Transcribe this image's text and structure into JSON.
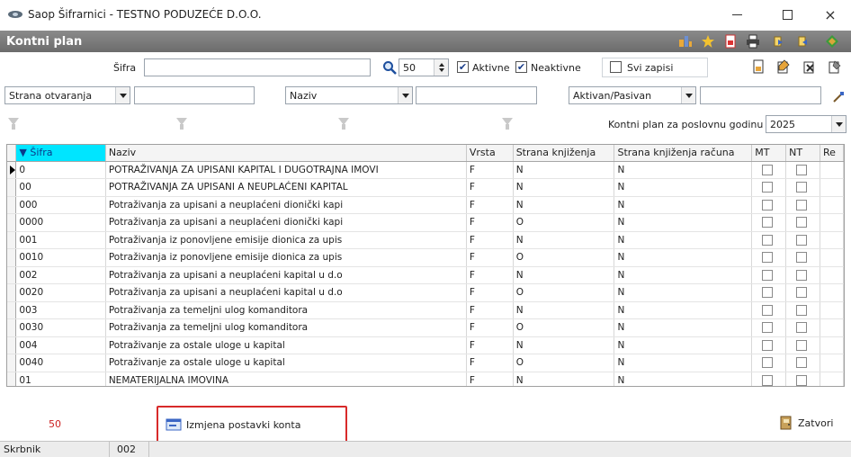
{
  "window": {
    "title": "Saop Šifrarnici - TESTNO PODUZEĆE D.O.O.",
    "minimize": "—",
    "maximize": "□",
    "close": "×"
  },
  "header": {
    "title": "Kontni plan"
  },
  "toolbar": {
    "sifra_label": "Šifra",
    "sifra_value": "",
    "page_size": "50",
    "aktivne_label": "Aktivne",
    "aktivne_checked": true,
    "neaktivne_label": "Neaktivne",
    "neaktivne_checked": true,
    "svi_zapisi_label": "Svi zapisi",
    "svi_zapisi_checked": false
  },
  "filters": {
    "filter1_field": "Strana otvaranja",
    "filter1_value": "",
    "filter2_field": "Naziv",
    "filter2_value": "",
    "filter3_field": "Aktivan/Pasivan",
    "filter3_value": "",
    "year_label": "Kontni plan za poslovnu godinu",
    "year_value": "2025"
  },
  "grid": {
    "columns": [
      "Šifra",
      "Naziv",
      "Vrsta",
      "Strana knjiženja",
      "Strana knjiženja računa",
      "MT",
      "NT",
      "Re"
    ],
    "rows": [
      [
        "0",
        "POTRAŽIVANJA ZA UPISANI KAPITAL I DUGOTRAJNA IMOVI",
        "F",
        "N",
        "N"
      ],
      [
        "00",
        "POTRAŽIVANJA ZA UPISANI A NEUPLAĆENI KAPITAL",
        "F",
        "N",
        "N"
      ],
      [
        "000",
        "Potraživanja za upisani a neuplaćeni dionički kapi",
        "F",
        "N",
        "N"
      ],
      [
        "0000",
        "Potraživanja za upisani a neuplaćeni dionički kapi",
        "F",
        "O",
        "N"
      ],
      [
        "001",
        "Potraživanja iz ponovljene emisije dionica za upis",
        "F",
        "N",
        "N"
      ],
      [
        "0010",
        "Potraživanja iz ponovljene emisije dionica za upis",
        "F",
        "O",
        "N"
      ],
      [
        "002",
        "Potraživanja za upisani a neuplaćeni kapital u d.o",
        "F",
        "N",
        "N"
      ],
      [
        "0020",
        "Potraživanja za upisani a neuplaćeni kapital u d.o",
        "F",
        "O",
        "N"
      ],
      [
        "003",
        "Potraživanja za temeljni ulog komanditora",
        "F",
        "N",
        "N"
      ],
      [
        "0030",
        "Potraživanja za temeljni ulog komanditora",
        "F",
        "O",
        "N"
      ],
      [
        "004",
        "Potraživanje za ostale uloge u kapital",
        "F",
        "N",
        "N"
      ],
      [
        "0040",
        "Potraživanje za ostale uloge u kapital",
        "F",
        "O",
        "N"
      ],
      [
        "01",
        "NEMATERIJALNA IMOVINA",
        "F",
        "N",
        "N"
      ]
    ]
  },
  "footer": {
    "record_count": "50",
    "change_settings_label": "Izmjena postavki konta",
    "close_label": "Zatvori"
  },
  "statusbar": {
    "user": "Skrbnik",
    "code": "002"
  },
  "colors": {
    "header_bg": "#7a7a7a",
    "sorted_column": "#00e5ff",
    "highlight_frame": "#d82a2a"
  }
}
